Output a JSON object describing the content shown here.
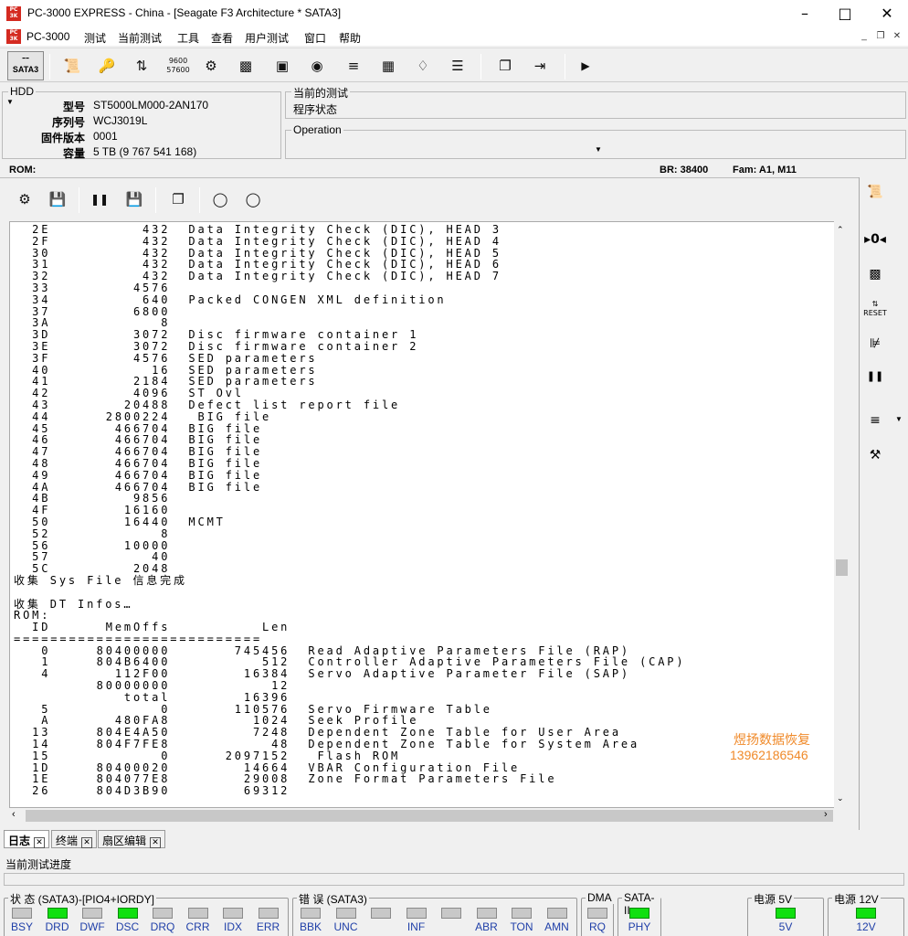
{
  "window": {
    "title": "PC-3000 EXPRESS - China - [Seagate F3 Architecture * SATA3]",
    "logo_text": "PC\n3000"
  },
  "menu": [
    "PC-3000",
    "测试",
    "当前测试",
    "工具",
    "查看",
    "用户测试",
    "窗口",
    "帮助"
  ],
  "toolbar": {
    "sata_label": "SATA3"
  },
  "hdd": {
    "caption": "HDD",
    "fields": [
      {
        "label": "型号",
        "value": "ST5000LM000-2AN170"
      },
      {
        "label": "序列号",
        "value": "WCJ3019L"
      },
      {
        "label": "固件版本",
        "value": "0001"
      },
      {
        "label": "容量",
        "value": "5 TB (9 767 541 168)"
      }
    ]
  },
  "current_test": {
    "caption": "当前的测试",
    "value": "程序状态"
  },
  "operation": {
    "caption": "Operation"
  },
  "romline": {
    "rom": "ROM:",
    "br": "BR: 38400",
    "fam": "Fam: A1, M11"
  },
  "log": {
    "text": "  2E          432  Data Integrity Check (DIC), HEAD 3\n  2F          432  Data Integrity Check (DIC), HEAD 4\n  30          432  Data Integrity Check (DIC), HEAD 5\n  31          432  Data Integrity Check (DIC), HEAD 6\n  32          432  Data Integrity Check (DIC), HEAD 7\n  33         4576\n  34          640  Packed CONGEN XML definition\n  37         6800\n  3A            8\n  3D         3072  Disc firmware container 1\n  3E         3072  Disc firmware container 2\n  3F         4576  SED parameters\n  40           16  SED parameters\n  41         2184  SED parameters\n  42         4096  ST Ovl\n  43        20488  Defect list report file\n  44      2800224   BIG file\n  45       466704  BIG file\n  46       466704  BIG file\n  47       466704  BIG file\n  48       466704  BIG file\n  49       466704  BIG file\n  4A       466704  BIG file\n  4B         9856\n  4F        16160\n  50        16440  MCMT\n  52            8\n  56        10000\n  57           40\n  5C         2048\n收集 Sys File 信息完成\n\n收集 DT Infos…\nROM:\n  ID      MemOffs          Len\n===========================\n   0     80400000       745456  Read Adaptive Parameters File (RAP)\n   1     804B6400          512  Controller Adaptive Parameters File (CAP)\n   4       112F00        16384  Servo Adaptive Parameter File (SAP)\n         80000000           12\n            total        16396\n   5            0       110576  Servo Firmware Table\n   A       480FA8         1024  Seek Profile\n  13     804E4A50         7248  Dependent Zone Table for User Area\n  14     804F7FE8           48  Dependent Zone Table for System Area\n  15            0      2097152   Flash ROM\n  1D     80400020        14664  VBAR Configuration File\n  1E     804077E8        29008  Zone Format Parameters File\n  26     804D3B90        69312",
    "watermark_line1": "煜扬数据恢复",
    "watermark_line2": "13962186546"
  },
  "tabs": [
    {
      "label": "日志",
      "active": true
    },
    {
      "label": "终端",
      "active": false
    },
    {
      "label": "扇区编辑",
      "active": false
    }
  ],
  "progress_label": "当前测试进度",
  "leds": {
    "status": {
      "caption": "状 态 (SATA3)-[PIO4+IORDY]",
      "items": [
        {
          "label": "BSY",
          "on": false
        },
        {
          "label": "DRD",
          "on": true
        },
        {
          "label": "DWF",
          "on": false
        },
        {
          "label": "DSC",
          "on": true
        },
        {
          "label": "DRQ",
          "on": false
        },
        {
          "label": "CRR",
          "on": false
        },
        {
          "label": "IDX",
          "on": false
        },
        {
          "label": "ERR",
          "on": false
        }
      ]
    },
    "error": {
      "caption": "错 误 (SATA3)",
      "items": [
        {
          "label": "BBK",
          "on": false
        },
        {
          "label": "UNC",
          "on": false
        },
        {
          "label": "",
          "on": false
        },
        {
          "label": "INF",
          "on": false
        },
        {
          "label": "",
          "on": false
        },
        {
          "label": "ABR",
          "on": false
        },
        {
          "label": "TON",
          "on": false
        },
        {
          "label": "AMN",
          "on": false
        }
      ]
    },
    "dma": {
      "caption": "DMA",
      "items": [
        {
          "label": "RQ",
          "on": false
        }
      ]
    },
    "sata": {
      "caption": "SATA-II",
      "items": [
        {
          "label": "PHY",
          "on": true
        }
      ]
    },
    "p5": {
      "caption": "电源 5V",
      "items": [
        {
          "label": "5V",
          "on": true
        }
      ]
    },
    "p12": {
      "caption": "电源 12V",
      "items": [
        {
          "label": "12V",
          "on": true
        }
      ]
    }
  }
}
